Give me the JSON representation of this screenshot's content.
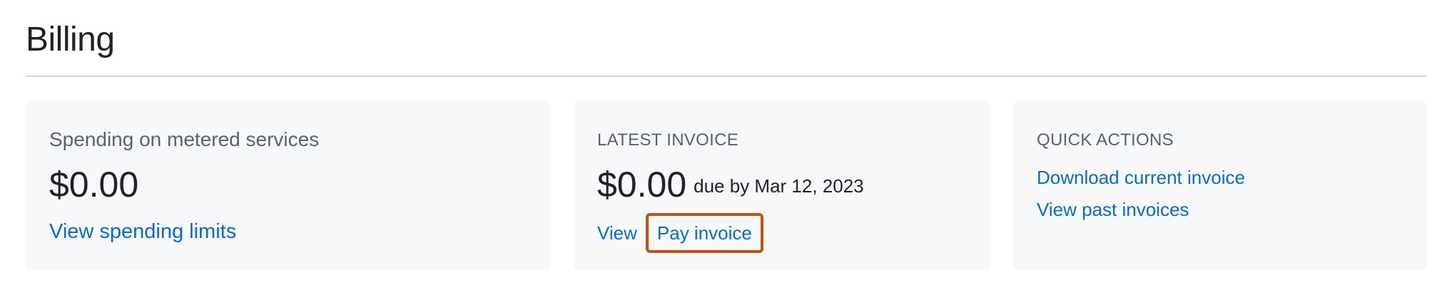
{
  "page": {
    "title": "Billing"
  },
  "spending_card": {
    "heading": "Spending on metered services",
    "amount": "$0.00",
    "link_label": "View spending limits"
  },
  "invoice_card": {
    "label": "LATEST INVOICE",
    "amount": "$0.00",
    "due_text": "due by Mar 12, 2023",
    "view_label": "View",
    "pay_label": "Pay invoice"
  },
  "actions_card": {
    "label": "QUICK ACTIONS",
    "links": [
      {
        "label": "Download current invoice"
      },
      {
        "label": "View past invoices"
      }
    ]
  },
  "colors": {
    "link": "#0969da",
    "highlight": "#c4520d",
    "card_background": "#f6f8fa"
  }
}
